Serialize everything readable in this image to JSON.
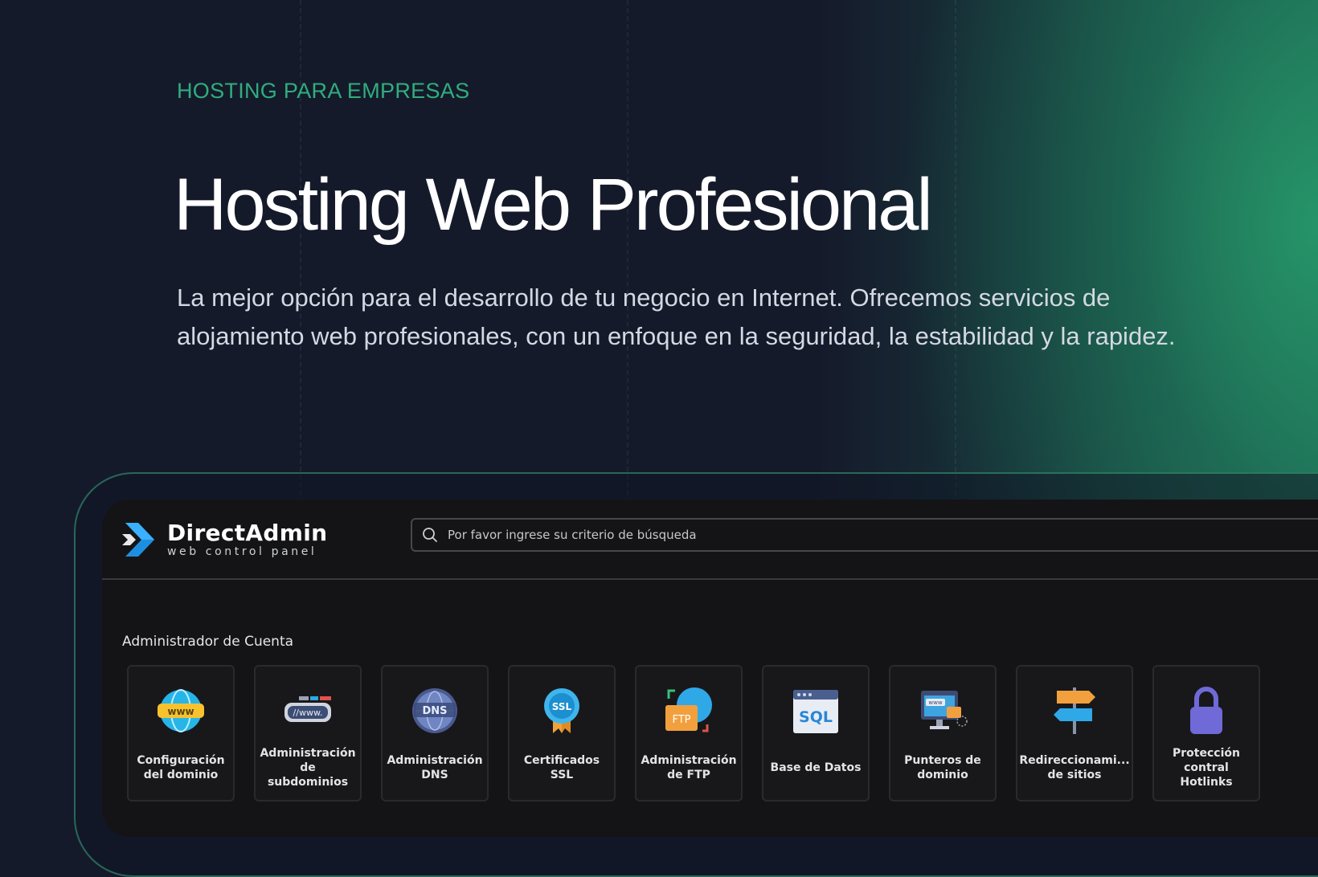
{
  "hero": {
    "eyebrow": "HOSTING PARA EMPRESAS",
    "title": "Hosting Web Profesional",
    "lead": "La mejor opción para el desarrollo de tu negocio en Internet. Ofrecemos servicios de alojamiento web profesionales, con un enfoque en la seguridad, la estabilidad y la rapidez."
  },
  "colors": {
    "accent": "#2fae7d",
    "background": "#151a2b",
    "panel": "#141416"
  },
  "panel": {
    "logo_name": "DirectAdmin",
    "logo_tagline": "web control panel",
    "search_placeholder": "Por favor ingrese su criterio de búsqueda",
    "section_title": "Administrador de Cuenta",
    "tiles": [
      {
        "label": "Configuración del dominio",
        "icon": "globe-www-icon"
      },
      {
        "label": "Administración de subdominios",
        "icon": "subdomain-www-icon"
      },
      {
        "label": "Administración DNS",
        "icon": "dns-globe-icon"
      },
      {
        "label": "Certificados SSL",
        "icon": "ssl-badge-icon"
      },
      {
        "label": "Administración de FTP",
        "icon": "ftp-folder-icon"
      },
      {
        "label": "Base de Datos",
        "icon": "sql-database-icon"
      },
      {
        "label": "Punteros de dominio",
        "icon": "domain-pointer-icon"
      },
      {
        "label": "Redireccionami... de sitios",
        "icon": "signpost-icon"
      },
      {
        "label": "Protección contral Hotlinks",
        "icon": "padlock-icon"
      }
    ]
  }
}
